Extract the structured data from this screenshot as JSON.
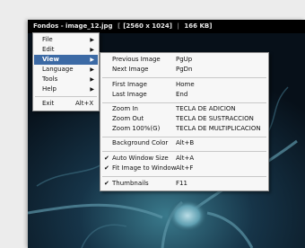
{
  "window": {
    "title": "Fondos - image_12.jpg",
    "dimensions": "[2560 x 1024]",
    "filesize": "166 KB]"
  },
  "main_menu": {
    "file": "File",
    "edit": "Edit",
    "view": "View",
    "language": "Language",
    "tools": "Tools",
    "help": "Help",
    "exit": "Exit",
    "exit_shortcut": "Alt+X"
  },
  "view_menu": {
    "previous_image": {
      "label": "Previous Image",
      "shortcut": "PgUp"
    },
    "next_image": {
      "label": "Next Image",
      "shortcut": "PgDn"
    },
    "first_image": {
      "label": "First Image",
      "shortcut": "Home"
    },
    "last_image": {
      "label": "Last Image",
      "shortcut": "End"
    },
    "zoom_in": {
      "label": "Zoom In",
      "shortcut": "TECLA DE ADICION"
    },
    "zoom_out": {
      "label": "Zoom Out",
      "shortcut": "TECLA DE SUSTRACCION"
    },
    "zoom_100": {
      "label": "Zoom 100%(G)",
      "shortcut": "TECLA DE MULTIPLICACION"
    },
    "background_color": {
      "label": "Background Color",
      "shortcut": "Alt+B"
    },
    "auto_window_size": {
      "label": "Auto Window Size",
      "shortcut": "Alt+A",
      "checked": true
    },
    "fit_image": {
      "label": "Fit Image to Window",
      "shortcut": "Alt+F",
      "checked": true
    },
    "thumbnails": {
      "label": "Thumbnails",
      "shortcut": "F11",
      "checked": true
    }
  },
  "colors": {
    "highlight": "#3c6aa5",
    "menu_bg": "#f7f7f7",
    "viewer_bg": "#0a1722"
  }
}
